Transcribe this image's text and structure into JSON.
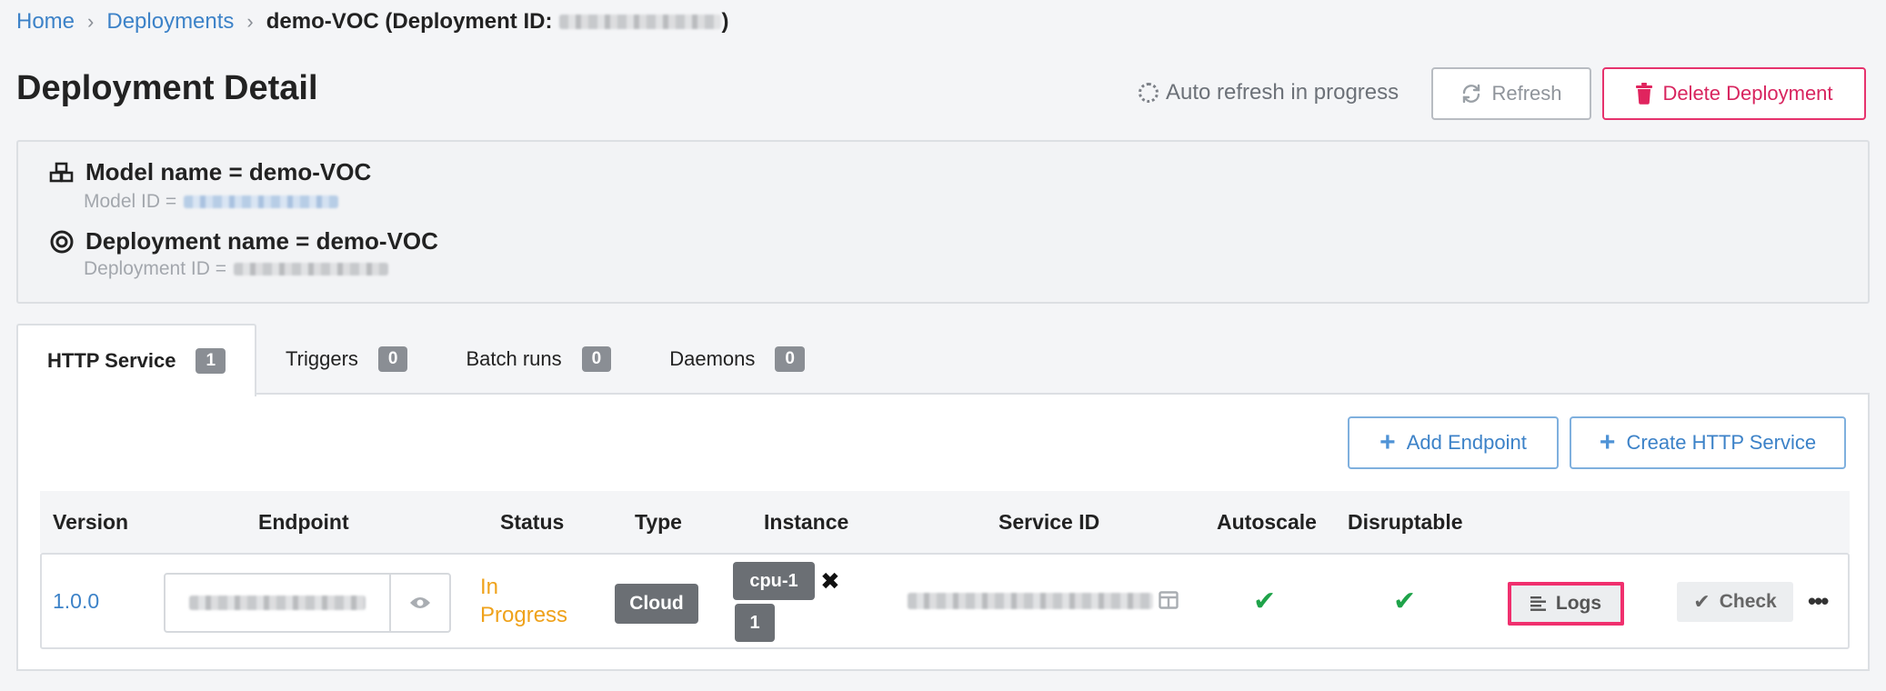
{
  "breadcrumb": {
    "home": "Home",
    "deployments": "Deployments",
    "current_prefix": "demo-VOC (Deployment ID:",
    "current_suffix": ")"
  },
  "header": {
    "title": "Deployment Detail",
    "auto_refresh": "Auto refresh in progress",
    "refresh_label": "Refresh",
    "delete_label": "Delete Deployment"
  },
  "info": {
    "model_name": "Model name = demo-VOC",
    "model_id_label": "Model ID =",
    "deployment_name": "Deployment name = demo-VOC",
    "deployment_id_label": "Deployment ID ="
  },
  "tabs": [
    {
      "label": "HTTP Service",
      "count": "1",
      "active": true
    },
    {
      "label": "Triggers",
      "count": "0",
      "active": false
    },
    {
      "label": "Batch runs",
      "count": "0",
      "active": false
    },
    {
      "label": "Daemons",
      "count": "0",
      "active": false
    }
  ],
  "actions": {
    "add_endpoint": "Add Endpoint",
    "create_http_service": "Create HTTP Service"
  },
  "table": {
    "columns": [
      "Version",
      "Endpoint",
      "Status",
      "Type",
      "Instance",
      "Service ID",
      "Autoscale",
      "Disruptable"
    ],
    "rows": [
      {
        "version": "1.0.0",
        "status_line1": "In",
        "status_line2": "Progress",
        "type": "Cloud",
        "instance_type": "cpu-1",
        "instance_count": "1",
        "autoscale": "✔",
        "disruptable": "✔",
        "logs_label": "Logs",
        "check_label": "Check",
        "more": "•••"
      }
    ]
  },
  "colors": {
    "link": "#3c82c8",
    "danger": "#e6336d",
    "warning": "#efa21b",
    "success": "#1fa34a"
  }
}
